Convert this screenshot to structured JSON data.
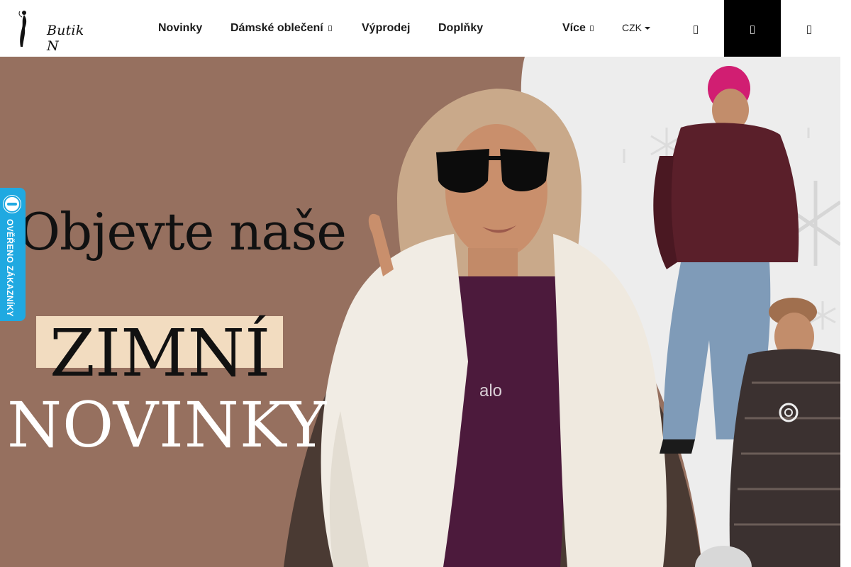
{
  "brand": {
    "logo_text": "Butik N"
  },
  "nav": {
    "items": [
      {
        "label": "Novinky",
        "has_submenu": false
      },
      {
        "label": "Dámské oblečení",
        "has_submenu": true
      },
      {
        "label": "Výprodej",
        "has_submenu": false
      },
      {
        "label": "Doplňky",
        "has_submenu": false
      }
    ],
    "more_label": "Více",
    "currency": "CZK"
  },
  "header_icons": [
    "search-icon",
    "user-icon",
    "cart-icon"
  ],
  "hero": {
    "line1": "Objevte naše",
    "line2": "ZIMNÍ",
    "line3": "NOVINKY",
    "shirt_print": "alo",
    "background_color": "#96705f",
    "highlight_color": "#f2dcc0"
  },
  "badge": {
    "label": "OVĚŘENO ZÁKAZNÍKY",
    "color": "#1fa9e1"
  }
}
